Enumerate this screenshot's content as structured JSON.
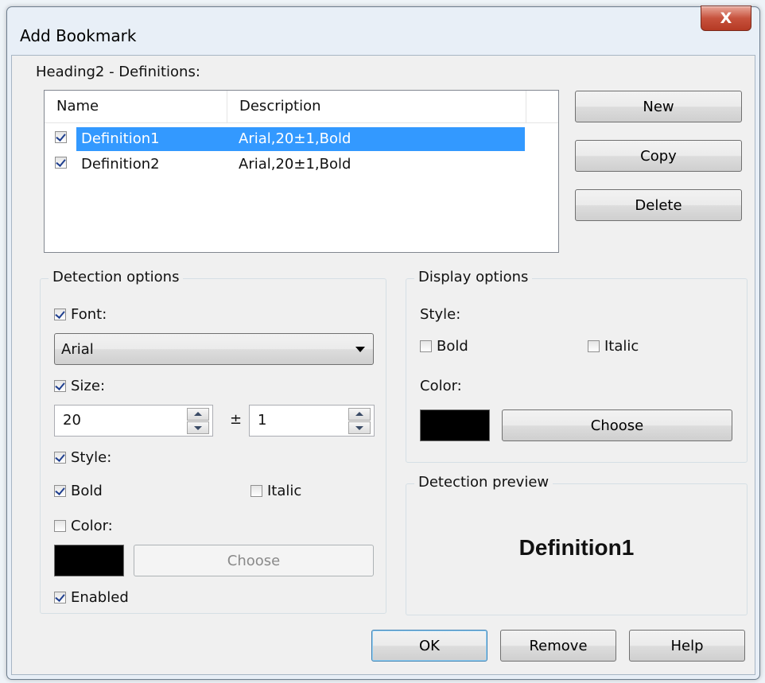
{
  "window": {
    "title": "Add Bookmark",
    "close_glyph": "X"
  },
  "definitions": {
    "label": "Heading2 - Definitions:",
    "columns": [
      "Name",
      "Description"
    ],
    "rows": [
      {
        "name": "Definition1",
        "description": "Arial,20±1,Bold",
        "checked": true,
        "selected": true
      },
      {
        "name": "Definition2",
        "description": "Arial,20±1,Bold",
        "checked": true,
        "selected": false
      }
    ]
  },
  "side_buttons": {
    "new": "New",
    "copy": "Copy",
    "delete": "Delete"
  },
  "detection": {
    "legend": "Detection options",
    "font_label": "Font:",
    "font_value": "Arial",
    "size_label": "Size:",
    "size_value": "20",
    "plusminus": "±",
    "tolerance_value": "1",
    "style_label": "Style:",
    "bold_label": "Bold",
    "italic_label": "Italic",
    "color_label": "Color:",
    "choose_label": "Choose",
    "enabled_label": "Enabled"
  },
  "display": {
    "legend": "Display options",
    "style_label": "Style:",
    "bold_label": "Bold",
    "italic_label": "Italic",
    "color_label": "Color:",
    "choose_label": "Choose"
  },
  "preview": {
    "legend": "Detection preview",
    "text": "Definition1"
  },
  "footer": {
    "ok": "OK",
    "remove": "Remove",
    "help": "Help"
  },
  "colors": {
    "selection": "#3399ff",
    "swatch": "#000000",
    "close_button": "#c7523d"
  }
}
